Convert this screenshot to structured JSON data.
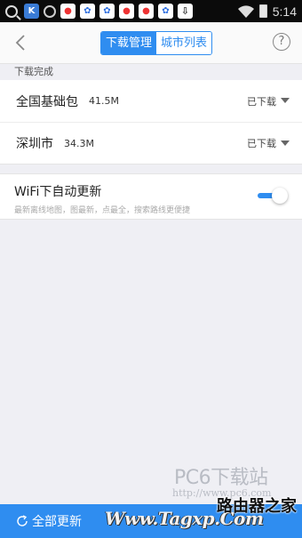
{
  "status_bar": {
    "time": "5:14",
    "icons": [
      "search-icon",
      "k-app-icon",
      "target-icon",
      "map-pin-app-icon",
      "paw-app-icon",
      "paw-app-icon",
      "map-pin-app-icon",
      "map-pin-app-icon",
      "paw-app-icon",
      "download-icon",
      "wifi-icon",
      "battery-icon"
    ]
  },
  "header": {
    "tabs": [
      {
        "label": "下载管理",
        "active": true
      },
      {
        "label": "城市列表",
        "active": false
      }
    ],
    "help_icon": "?"
  },
  "section": {
    "title": "下载完成"
  },
  "downloads": [
    {
      "name": "全国基础包",
      "size": "41.5M",
      "status": "已下载"
    },
    {
      "name": "深圳市",
      "size": "34.3M",
      "status": "已下载"
    }
  ],
  "wifi_setting": {
    "title": "WiFi下自动更新",
    "subtitle": "最新离线地图，图最新，点最全，搜索路线更便捷",
    "enabled": true
  },
  "watermark": {
    "brand": "PC6下载站",
    "url": "http://www.pc6.com",
    "bottom": "Www.Tagxp.Com",
    "corner": "路由器之家"
  },
  "bottom_bar": {
    "update_all": "全部更新"
  },
  "colors": {
    "accent": "#2f8df0",
    "background": "#efeff4",
    "status_bar": "#0b0b0b"
  }
}
